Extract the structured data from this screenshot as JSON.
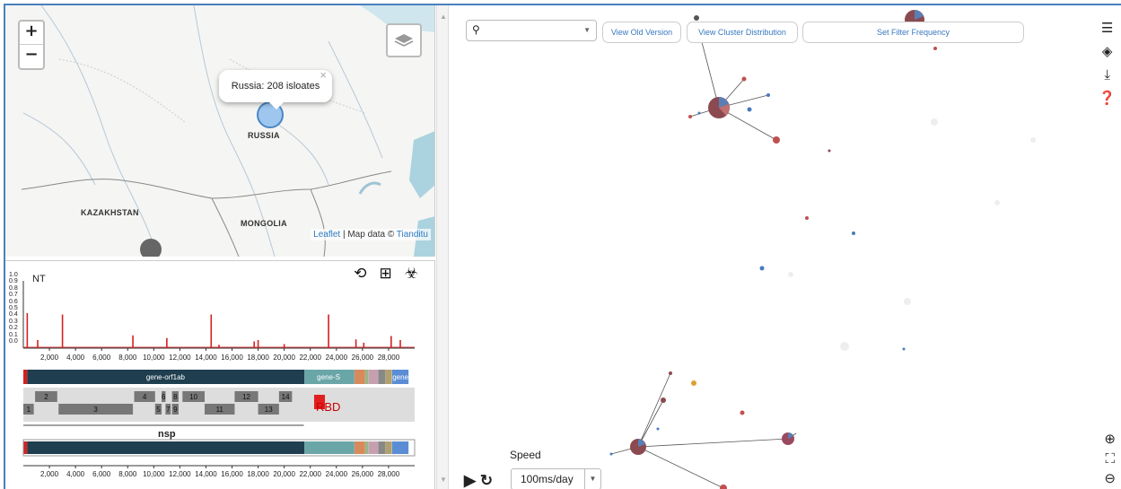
{
  "map": {
    "zoom_in": "+",
    "zoom_out": "−",
    "popup_text": "Russia: 208 isloates",
    "popup_close": "×",
    "labels": {
      "russia": "RUSSIA",
      "kazakhstan": "KAZAKHSTAN",
      "mongolia": "MONGOLIA"
    },
    "attribution": {
      "leaflet": "Leaflet",
      "sep": " | Map data © ",
      "provider": "Tianditu"
    },
    "marker_color": "#5b9bd5"
  },
  "genome": {
    "ylabel": "NT",
    "yticks": [
      "1.0",
      "0.9",
      "0.8",
      "0.7",
      "0.6",
      "0.5",
      "0.4",
      "0.3",
      "0.2",
      "0.1",
      "0.0"
    ],
    "xticks": [
      "2,000",
      "4,000",
      "6,000",
      "8,000",
      "10,000",
      "12,000",
      "14,000",
      "16,000",
      "18,000",
      "20,000",
      "22,000",
      "24,000",
      "26,000",
      "28,000"
    ],
    "genes": [
      {
        "label": "gene-orf1ab",
        "color": "#1f3e4f"
      },
      {
        "label": "gene-S",
        "color": "#6aa6a8"
      },
      {
        "label": "gene-N",
        "color": "#5b8dd5"
      }
    ],
    "nsp_top": [
      "2",
      "4",
      "6",
      "8",
      "10",
      "12",
      "14",
      "16"
    ],
    "nsp_bottom": [
      "1",
      "3",
      "5",
      "7",
      "9",
      "11",
      "13",
      "15"
    ],
    "nsp_label": "nsp",
    "rbd_label": "RBD",
    "rbd_color": "#e02020",
    "icons": [
      "history-icon",
      "table-icon",
      "biohazard-icon"
    ]
  },
  "network": {
    "search_placeholder": "",
    "buttons": {
      "old_version": "View Old Version",
      "cluster_distribution": "View Cluster Distribution",
      "filter_frequency": "Set Filter Frequency"
    },
    "speed_label": "Speed",
    "speed_value": "100ms/day",
    "right_icons": [
      "sliders-icon",
      "layers-icon",
      "download-icon",
      "help-icon"
    ],
    "zoom_icons": [
      "zoom-in-icon",
      "fullscreen-icon",
      "zoom-out-icon"
    ]
  },
  "chart_data": {
    "type": "bar",
    "title": "",
    "ylabel": "NT",
    "ylim": [
      0,
      1
    ],
    "xlim": [
      0,
      30000
    ],
    "x": [
      300,
      1100,
      3000,
      8400,
      11000,
      14400,
      15000,
      17700,
      18000,
      20000,
      23400,
      25500,
      26100,
      28200,
      28900
    ],
    "values": [
      0.52,
      0.12,
      0.5,
      0.19,
      0.15,
      0.5,
      0.05,
      0.1,
      0.12,
      0.06,
      0.5,
      0.13,
      0.08,
      0.18,
      0.12
    ]
  }
}
